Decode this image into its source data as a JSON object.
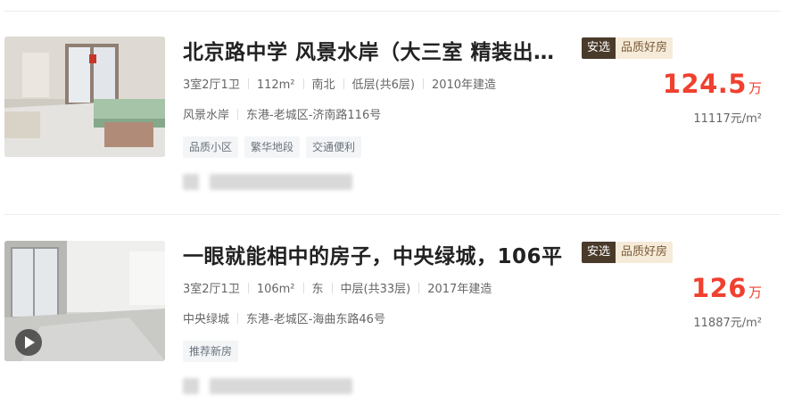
{
  "listings": [
    {
      "title": "北京路中学 风景水岸（大三室 精装出售）",
      "badge_primary": "安选",
      "badge_secondary": "品质好房",
      "specs": [
        "3室2厅1卫",
        "112m²",
        "南北",
        "低层(共6层)",
        "2010年建造"
      ],
      "community": "风景水岸",
      "address": "东港-老城区-济南路116号",
      "tags": [
        "品质小区",
        "繁华地段",
        "交通便利"
      ],
      "price": "124.5",
      "price_unit": "万",
      "unit_price": "11117元/m²",
      "has_video": false
    },
    {
      "title": "一眼就能相中的房子，中央绿城，106平",
      "badge_primary": "安选",
      "badge_secondary": "品质好房",
      "specs": [
        "3室2厅1卫",
        "106m²",
        "东",
        "中层(共33层)",
        "2017年建造"
      ],
      "community": "中央绿城",
      "address": "东港-老城区-海曲东路46号",
      "tags": [
        "推荐新房"
      ],
      "price": "126",
      "price_unit": "万",
      "unit_price": "11887元/m²",
      "has_video": true
    }
  ]
}
